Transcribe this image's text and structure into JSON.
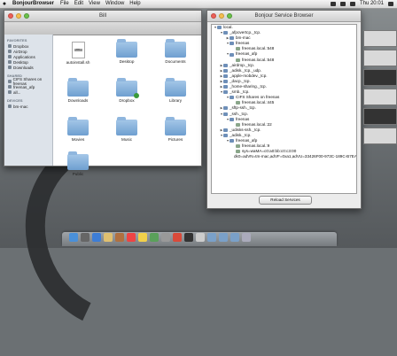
{
  "menubar": {
    "app_name": "BonjourBrowser",
    "items": [
      "File",
      "Edit",
      "View",
      "Window",
      "Help"
    ],
    "clock": "Thu 20:01"
  },
  "finder": {
    "title": "Bill",
    "sidebar": {
      "favorites_header": "FAVORITES",
      "favorites": [
        "Dropbox",
        "AirDrop",
        "Applications",
        "Desktop",
        "Downloads"
      ],
      "shared_header": "SHARED",
      "shared": [
        "CIFS Shares on freenas",
        "freenas_afp",
        "all..."
      ],
      "devices_header": "DEVICES",
      "devices": [
        "bm-mac"
      ]
    },
    "items": [
      {
        "name": "autoinstall.sh",
        "kind": "doc",
        "doc_label": "exec"
      },
      {
        "name": "Desktop",
        "kind": "folder"
      },
      {
        "name": "Documents",
        "kind": "folder"
      },
      {
        "name": "Downloads",
        "kind": "folder"
      },
      {
        "name": "Dropbox",
        "kind": "folder"
      },
      {
        "name": "Library",
        "kind": "folder"
      },
      {
        "name": "Movies",
        "kind": "folder"
      },
      {
        "name": "Music",
        "kind": "folder"
      },
      {
        "name": "Pictures",
        "kind": "folder"
      },
      {
        "name": "Public",
        "kind": "folder"
      }
    ]
  },
  "bonjour": {
    "title": "Bonjour Service Browser",
    "tree": [
      {
        "depth": 0,
        "open": true,
        "label": "local."
      },
      {
        "depth": 1,
        "open": true,
        "label": "_afpovertcp._tcp."
      },
      {
        "depth": 2,
        "open": false,
        "label": "bm-mac"
      },
      {
        "depth": 2,
        "open": true,
        "label": "freenas"
      },
      {
        "depth": 3,
        "open": null,
        "label": "freenas.local.:548"
      },
      {
        "depth": 2,
        "open": true,
        "label": "freenas_afp"
      },
      {
        "depth": 3,
        "open": null,
        "label": "freenas.local.:548"
      },
      {
        "depth": 1,
        "open": false,
        "label": "_airdrop._tcp."
      },
      {
        "depth": 1,
        "open": false,
        "label": "_adisk._tcp._udp."
      },
      {
        "depth": 1,
        "open": false,
        "label": "_apple-mobdev._tcp."
      },
      {
        "depth": 1,
        "open": false,
        "label": "_dacp._tcp."
      },
      {
        "depth": 1,
        "open": false,
        "label": "_home-sharing._tcp."
      },
      {
        "depth": 1,
        "open": true,
        "label": "_smb._tcp."
      },
      {
        "depth": 2,
        "open": true,
        "label": "CIFS Shares on freenas"
      },
      {
        "depth": 3,
        "open": null,
        "label": "freenas.local.:445"
      },
      {
        "depth": 1,
        "open": false,
        "label": "_sftp-ssh._tcp."
      },
      {
        "depth": 1,
        "open": true,
        "label": "_ssh._tcp."
      },
      {
        "depth": 2,
        "open": true,
        "label": "freenas"
      },
      {
        "depth": 3,
        "open": null,
        "label": "freenas.local.:22"
      },
      {
        "depth": 1,
        "open": false,
        "label": "_udisks-ssh._tcp."
      },
      {
        "depth": 1,
        "open": true,
        "label": "_adisk._tcp."
      },
      {
        "depth": 2,
        "open": true,
        "label": "freenas_afp"
      },
      {
        "depth": 3,
        "open": null,
        "label": "freenas.local.:9"
      },
      {
        "depth": 3,
        "open": null,
        "label": "sys=waMA=c0:a0:bb:c0:c3:00"
      },
      {
        "depth": 3,
        "open": null,
        "label": "dk0=adVN=tm-mac,adVF=0xa1,adVU=33426F00-973C-189C-B7EA-5C"
      }
    ],
    "reload_label": "Reload Services"
  }
}
